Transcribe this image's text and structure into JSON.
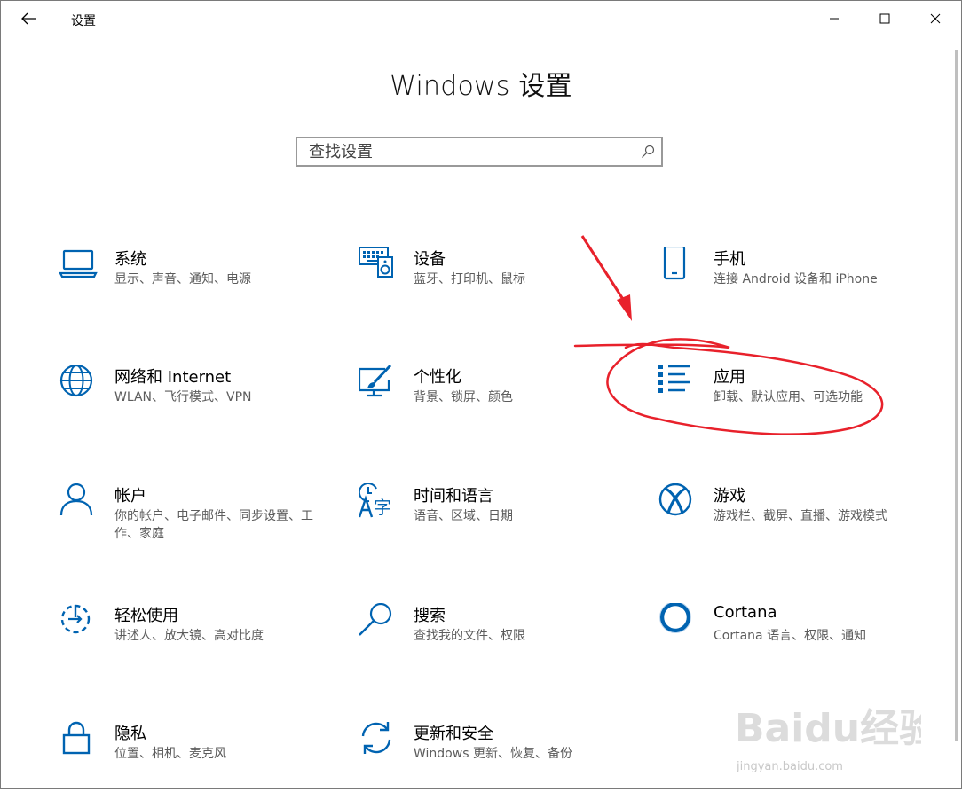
{
  "window": {
    "title": "设置",
    "back_icon": "back-arrow-icon",
    "controls": [
      "minimize-icon",
      "maximize-icon",
      "close-icon"
    ]
  },
  "page": {
    "title": "Windows 设置"
  },
  "search": {
    "placeholder": "查找设置",
    "icon": "search-icon"
  },
  "accent_color": "#0063b1",
  "annotation_color": "#e8212b",
  "tiles": [
    {
      "name": "系统",
      "desc": "显示、声音、通知、电源",
      "icon": "laptop-icon"
    },
    {
      "name": "设备",
      "desc": "蓝牙、打印机、鼠标",
      "icon": "keyboard-speaker-icon"
    },
    {
      "name": "手机",
      "desc": "连接 Android 设备和 iPhone",
      "icon": "phone-icon"
    },
    {
      "name": "网络和 Internet",
      "desc": "WLAN、飞行模式、VPN",
      "icon": "globe-icon"
    },
    {
      "name": "个性化",
      "desc": "背景、锁屏、颜色",
      "icon": "paintbrush-icon"
    },
    {
      "name": "应用",
      "desc": "卸载、默认应用、可选功能",
      "icon": "apps-list-icon"
    },
    {
      "name": "帐户",
      "desc": "你的帐户、电子邮件、同步设置、工作、家庭",
      "icon": "person-icon"
    },
    {
      "name": "时间和语言",
      "desc": "语音、区域、日期",
      "icon": "time-language-icon"
    },
    {
      "name": "游戏",
      "desc": "游戏栏、截屏、直播、游戏模式",
      "icon": "xbox-icon"
    },
    {
      "name": "轻松使用",
      "desc": "讲述人、放大镜、高对比度",
      "icon": "ease-of-access-icon"
    },
    {
      "name": "搜索",
      "desc": "查找我的文件、权限",
      "icon": "magnifier-icon"
    },
    {
      "name": "Cortana",
      "desc": "Cortana 语言、权限、通知",
      "icon": "cortana-ring-icon"
    },
    {
      "name": "隐私",
      "desc": "位置、相机、麦克风",
      "icon": "lock-icon"
    },
    {
      "name": "更新和安全",
      "desc": "Windows 更新、恢复、备份",
      "icon": "sync-arrows-icon"
    }
  ],
  "watermark": {
    "brand": "Baidu经验",
    "url": "jingyan.baidu.com"
  }
}
